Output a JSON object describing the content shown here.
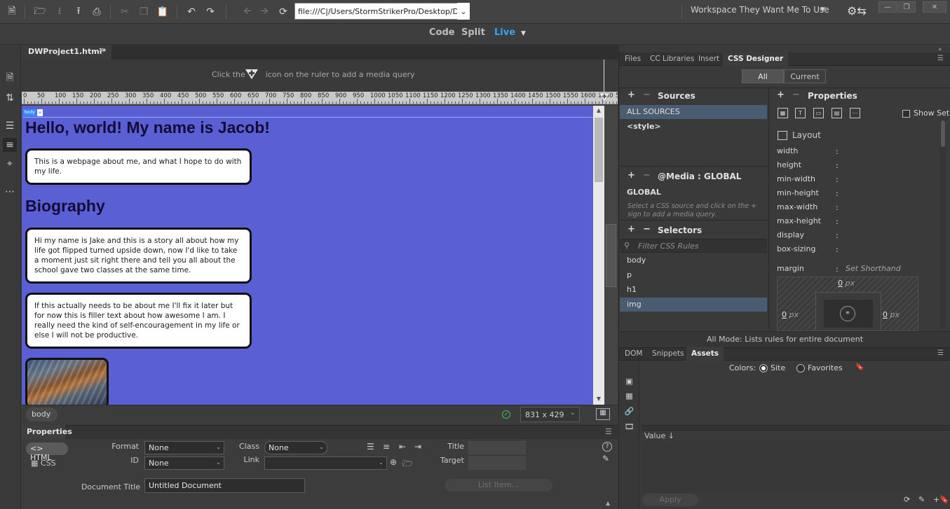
{
  "toolbar": {
    "url": "file:///C|/Users/StormStrikerPro/Desktop/Digita",
    "workspace": "Workspace They Want Me To Use"
  },
  "views": {
    "code": "Code",
    "split": "Split",
    "live": "Live"
  },
  "document": {
    "tab_label": "DWProject1.html*",
    "media_query_hint_before": "Click the",
    "media_query_hint_after": "icon on the ruler to add a media query",
    "ruler_labels": [
      "0",
      "50",
      "100",
      "150",
      "200",
      "250",
      "300",
      "350",
      "400",
      "450",
      "500",
      "550",
      "600",
      "650",
      "700",
      "750",
      "800",
      "850",
      "900",
      "950",
      "1000",
      "1050",
      "1100",
      "1150",
      "1200",
      "1250",
      "1300",
      "1350",
      "1400",
      "1450",
      "1500",
      "1550",
      "1600",
      "1650"
    ],
    "ruler_end": "50"
  },
  "live_view": {
    "body_tag": "body",
    "heading": "Hello, world! My name is Jacob!",
    "intro": "This is a webpage about me, and what I hope to do with my life.",
    "section_heading": "Biography",
    "para1": "Hi my name is Jake and this is a story all about how my life got flipped turned upside down, now I'd like to take a moment just sit right there and tell you all about the school gave two classes at the same time.",
    "para2": "If this actually needs to be about me I'll fix it later but for now this is filler text about how awesome I am. I really need the kind of self-encouragement in my life or else I will not be productive.",
    "background_color": "#5b5fd4"
  },
  "status": {
    "tag": "body",
    "viewport_size": "831 x 429"
  },
  "properties": {
    "title": "Properties",
    "html_label": "HTML",
    "css_label": "CSS",
    "format_label": "Format",
    "format_value": "None",
    "id_label": "ID",
    "id_value": "None",
    "class_label": "Class",
    "class_value": "None",
    "link_label": "Link",
    "title_label": "Title",
    "target_label": "Target",
    "doc_title_label": "Document Title",
    "doc_title_value": "Untitled Document",
    "list_item_button": "List Item..."
  },
  "right_panel": {
    "tabs": [
      "Files",
      "CC Libraries",
      "Insert",
      "CSS Designer"
    ],
    "segment_all": "All",
    "segment_current": "Current",
    "sources_title": "Sources",
    "sources": [
      "ALL SOURCES",
      "<style>"
    ],
    "media_title": "@Media :",
    "media_scope": "GLOBAL",
    "media_items": [
      "GLOBAL"
    ],
    "media_hint": "Select a CSS source and click on the + sign to add a media query.",
    "selectors_title": "Selectors",
    "filter_placeholder": "Filter CSS Rules",
    "selectors": [
      "body",
      "p",
      "h1",
      "img"
    ],
    "properties_title": "Properties",
    "show_set": "Show Set",
    "layout_title": "Layout",
    "layout_props": [
      "width",
      "height",
      "min-width",
      "min-height",
      "max-width",
      "max-height",
      "display",
      "box-sizing"
    ],
    "colon": ":",
    "margin_label": "margin",
    "set_shorthand": "Set Shorthand",
    "margin_top": "0",
    "margin_left": "0",
    "margin_right": "0",
    "unit": "px",
    "all_mode": "All Mode: Lists rules for entire document"
  },
  "bottom_panel": {
    "tabs": [
      "DOM",
      "Snippets",
      "Assets"
    ],
    "colors_label": "Colors:",
    "site_label": "Site",
    "favorites_label": "Favorites",
    "value_header": "Value",
    "apply_button": "Apply"
  },
  "colors": {
    "accent": "#2fa6ff",
    "selection": "#4a5c72"
  }
}
